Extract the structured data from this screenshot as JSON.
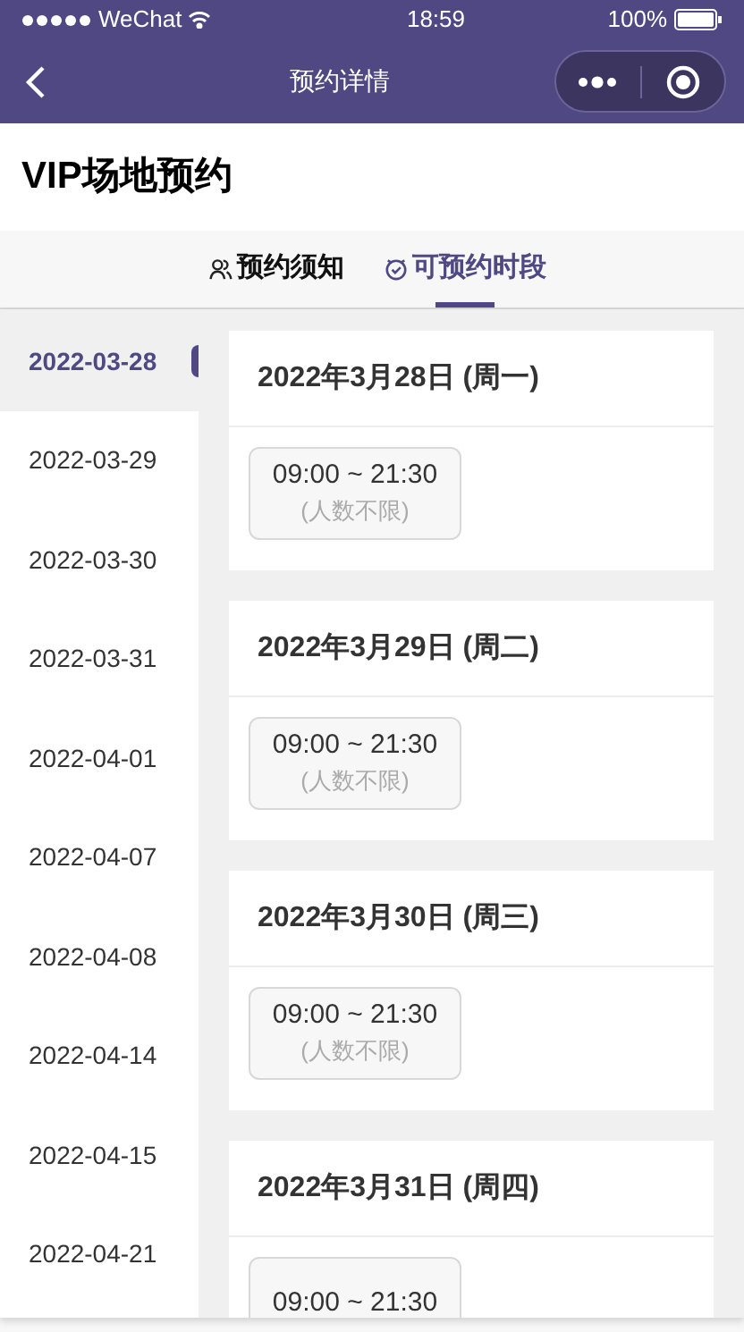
{
  "status_bar": {
    "carrier": "WeChat",
    "time": "18:59",
    "battery": "100%"
  },
  "nav": {
    "title": "预约详情"
  },
  "page_title": "VIP场地预约",
  "tabs": [
    {
      "label": "预约须知",
      "kind": "people",
      "selected": false
    },
    {
      "label": "可预约时段",
      "kind": "clock",
      "selected": true
    }
  ],
  "dates": [
    {
      "label": "2022-03-28",
      "selected": true
    },
    {
      "label": "2022-03-29",
      "selected": false
    },
    {
      "label": "2022-03-30",
      "selected": false
    },
    {
      "label": "2022-03-31",
      "selected": false
    },
    {
      "label": "2022-04-01",
      "selected": false
    },
    {
      "label": "2022-04-07",
      "selected": false
    },
    {
      "label": "2022-04-08",
      "selected": false
    },
    {
      "label": "2022-04-14",
      "selected": false
    },
    {
      "label": "2022-04-15",
      "selected": false
    },
    {
      "label": "2022-04-21",
      "selected": false
    }
  ],
  "days": [
    {
      "heading": "2022年3月28日 (周一)",
      "slots": [
        {
          "time": "09:00 ~ 21:30",
          "note": "(人数不限)"
        }
      ]
    },
    {
      "heading": "2022年3月29日 (周二)",
      "slots": [
        {
          "time": "09:00 ~ 21:30",
          "note": "(人数不限)"
        }
      ]
    },
    {
      "heading": "2022年3月30日 (周三)",
      "slots": [
        {
          "time": "09:00 ~ 21:30",
          "note": "(人数不限)"
        }
      ]
    },
    {
      "heading": "2022年3月31日 (周四)",
      "slots": [
        {
          "time": "09:00 ~ 21:30"
        }
      ]
    }
  ]
}
